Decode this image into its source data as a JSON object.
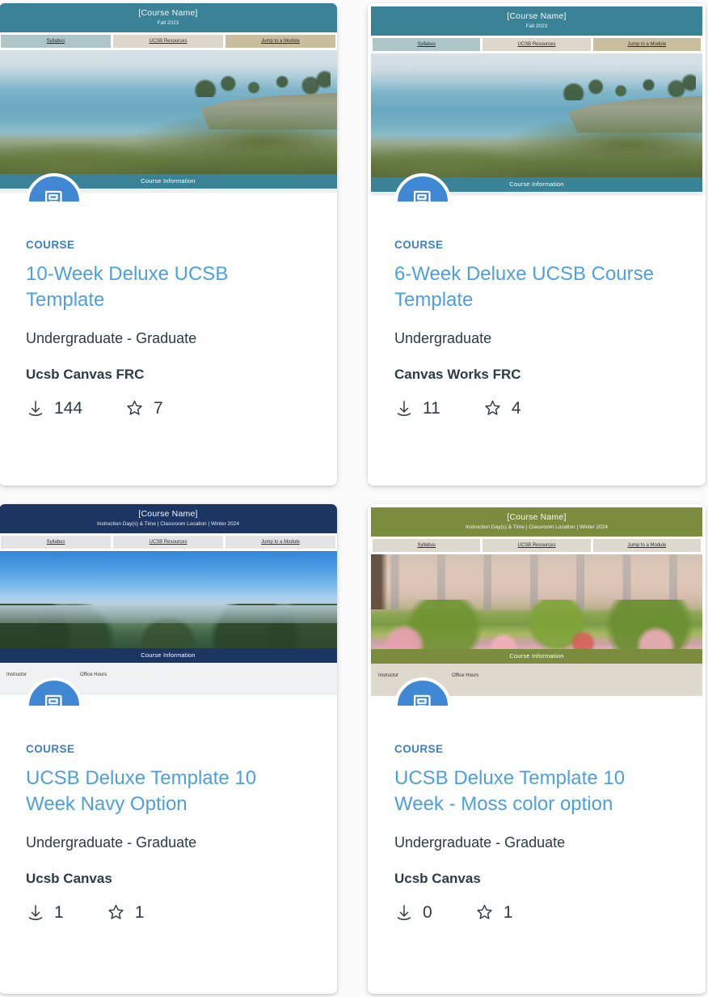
{
  "page": {
    "background_color": "#fbfbfb",
    "card_background": "#ffffff",
    "link_color": "#4c9fe0",
    "kicker_color": "#3c80c4",
    "text_color": "#2d3b45",
    "avatar_color": "#4188d4"
  },
  "icons": {
    "course": "book-icon",
    "downloads": "download-icon",
    "favorites": "star-outline-icon"
  },
  "cards": [
    {
      "kicker": "COURSE",
      "title": "10-Week Deluxe UCSB Template",
      "level": "Undergraduate - Graduate",
      "author": "Ucsb Canvas FRC",
      "downloads": "144",
      "favorites": "7",
      "thumbnail": {
        "header_title": "[Course Name]",
        "header_sub": "Fall 2023",
        "nav": [
          "Syllabus",
          "UCSB Resources",
          "Jump to a Module"
        ],
        "info_bar": "Course Information",
        "theme": "teal",
        "header_color": "#3a8296",
        "infobar_color": "#3a8296",
        "nav_colors": [
          "#aec6c8",
          "#ddd6cb",
          "#c9bf9e"
        ],
        "photo": "coastal-cliff-photo"
      }
    },
    {
      "kicker": "COURSE",
      "title": "6-Week Deluxe UCSB Course Template",
      "level": "Undergraduate",
      "author": "Canvas Works FRC",
      "downloads": "11",
      "favorites": "4",
      "thumbnail": {
        "header_title": "[Course Name]",
        "header_sub": "Fall 2023",
        "nav": [
          "Syllabus",
          "UCSB Resources",
          "Jump to a Module"
        ],
        "info_bar": "Course Information",
        "theme": "teal",
        "header_color": "#3a8296",
        "infobar_color": "#3a8296",
        "nav_colors": [
          "#aec6c8",
          "#ddd6cb",
          "#c9bf9e"
        ],
        "photo": "coastal-cliff-photo"
      }
    },
    {
      "kicker": "COURSE",
      "title": "UCSB Deluxe Template 10 Week Navy Option",
      "level": "Undergraduate - Graduate",
      "author": "Ucsb Canvas",
      "downloads": "1",
      "favorites": "1",
      "thumbnail": {
        "header_title": "[Course Name]",
        "header_sub": "Instruction Day(s) & Time | Classroom Location | Winter 2024",
        "nav": [
          "Syllabus",
          "UCSB Resources",
          "Jump to a Module"
        ],
        "info_bar": "Course Information",
        "table_label": "Instructor",
        "table_label2": "Office Hours",
        "theme": "navy",
        "header_color": "#1d3562",
        "infobar_color": "#1d3562",
        "nav_colors": [
          "#e3e4e6",
          "#e3e4e6",
          "#e3e4e6"
        ],
        "table_color": "#f0f1f3",
        "photo": "lagoon-panorama-photo"
      }
    },
    {
      "kicker": "COURSE",
      "title": "UCSB Deluxe Template 10 Week - Moss color option",
      "level": "Undergraduate - Graduate",
      "author": "Ucsb Canvas",
      "downloads": "0",
      "favorites": "1",
      "thumbnail": {
        "header_title": "[Course Name]",
        "header_sub": "Instruction Day(s) & Time | Classroom Location | Winter 2024",
        "nav": [
          "Syllabus",
          "UCSB Resources",
          "Jump to a Module"
        ],
        "info_bar": "Course Information",
        "table_label": "Instructor",
        "table_label2": "Office Hours",
        "theme": "moss",
        "header_color": "#7b8c3e",
        "infobar_color": "#7b8c3e",
        "nav_colors": [
          "#ded9cd",
          "#ded9cd",
          "#ded9cd"
        ],
        "table_color": "#ded9cd",
        "photo": "campus-garden-photo"
      }
    }
  ]
}
